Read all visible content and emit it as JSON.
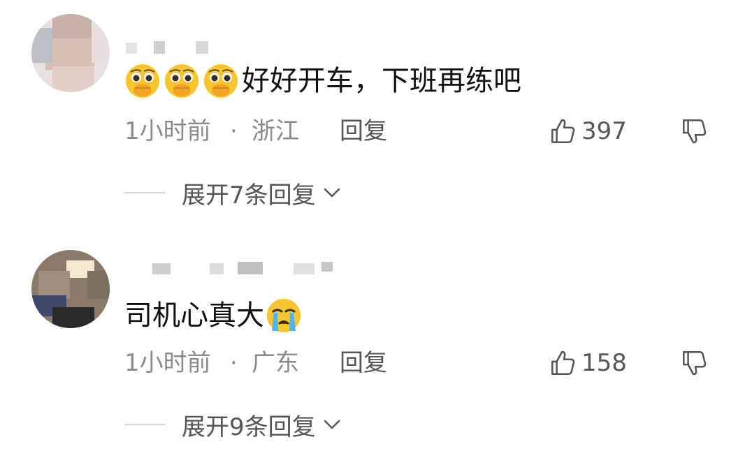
{
  "comments": [
    {
      "text": "好好开车，下班再练吧",
      "emojis": [
        "face-covering-mouth-emoji",
        "face-covering-mouth-emoji",
        "face-covering-mouth-emoji"
      ],
      "time": "1小时前",
      "separator": "·",
      "location": "浙江",
      "reply_label": "回复",
      "likes": "397",
      "expand_label": "展开7条回复"
    },
    {
      "text": "司机心真大",
      "emojis": [
        "crying-face-emoji"
      ],
      "time": "1小时前",
      "separator": "·",
      "location": "广东",
      "reply_label": "回复",
      "likes": "158",
      "expand_label": "展开9条回复"
    }
  ],
  "icons": {
    "like": "thumbs-up-icon",
    "dislike": "thumbs-down-icon",
    "expand": "chevron-down-icon"
  },
  "colors": {
    "meta_text": "#8a8a8a",
    "action_text": "#555555",
    "body_text": "#111111",
    "emoji_yellow": "#f7c531"
  }
}
